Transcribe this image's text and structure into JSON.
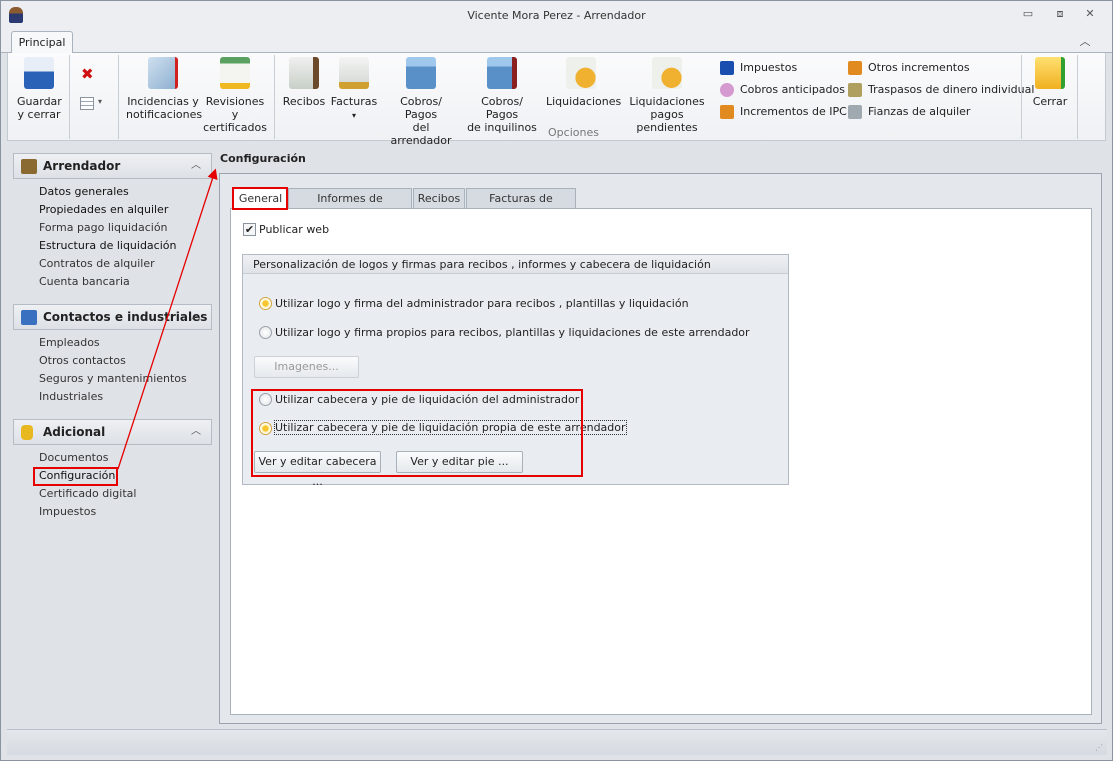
{
  "window": {
    "title": "Vicente Mora Perez - Arrendador",
    "minimize": "▭",
    "restore": "⧈",
    "close": "✕",
    "collapse": "︿"
  },
  "ribbon": {
    "tab": "Principal",
    "buttons": [
      {
        "label1": "Guardar",
        "label2": "y cerrar",
        "icon": "save-icon"
      },
      {
        "label1": "Incidencias y",
        "label2": "notificaciones",
        "icon": "incidents-icon"
      },
      {
        "label1": "Revisiones y",
        "label2": "certificados",
        "icon": "bell-icon"
      },
      {
        "label1": "Recibos",
        "label2": "",
        "icon": "receipt-icon"
      },
      {
        "label1": "Facturas",
        "label2": "▾",
        "icon": "invoice-icon"
      },
      {
        "label1": "Cobros/ Pagos",
        "label2": "del arrendador",
        "icon": "calculator-icon"
      },
      {
        "label1": "Cobros/ Pagos",
        "label2": "de inquilinos",
        "icon": "calculator-user-icon"
      },
      {
        "label1": "Liquidaciones",
        "label2": "",
        "icon": "certificate-icon"
      },
      {
        "label1": "Liquidaciones",
        "label2": "pagos pendientes",
        "icon": "certificate-icon"
      },
      {
        "label1": "Cerrar",
        "label2": "",
        "icon": "folder-exit-icon"
      }
    ],
    "small": [
      {
        "label": "Impuestos",
        "color": "#1a4fb0"
      },
      {
        "label": "Cobros anticipados",
        "color": "#d59ad0"
      },
      {
        "label": "Incrementos de IPC",
        "color": "#e08a20"
      },
      {
        "label": "Otros incrementos",
        "color": "#e08a20"
      },
      {
        "label": "Traspasos de dinero individual",
        "color": "#b0a060"
      },
      {
        "label": "Fianzas de alquiler",
        "color": "#a0a8b0"
      }
    ],
    "group_label": "Opciones"
  },
  "sidebar": {
    "sections": [
      {
        "title": "Arrendador",
        "items": [
          "Datos generales",
          "Propiedades en alquiler",
          "Forma pago liquidación",
          "Estructura de liquidación",
          "Contratos de alquiler",
          "Cuenta bancaria"
        ]
      },
      {
        "title": "Contactos e industriales",
        "items": [
          "Empleados",
          "Otros contactos",
          "Seguros y mantenimientos",
          "Industriales"
        ]
      },
      {
        "title": "Adicional",
        "items": [
          "Documentos",
          "Configuración",
          "Certificado digital",
          "Impuestos"
        ]
      }
    ]
  },
  "main": {
    "title": "Configuración",
    "tabs": [
      "General",
      "Informes de liquidación",
      "Recibos",
      "Facturas de alquiler"
    ],
    "publicar_web": "Publicar web",
    "group_title": "Personalización de logos y firmas para recibos , informes y cabecera de liquidación",
    "radio1": "Utilizar logo y firma del administrador para recibos , plantillas y liquidación",
    "radio2": "Utilizar logo y firma propios para recibos, plantillas y liquidaciones de este arrendador",
    "imagenes": "Imagenes...",
    "radio3": "Utilizar cabecera y pie de liquidación del administrador",
    "radio4": "Utilizar cabecera y pie de liquidación propia de este arrendador",
    "ver_cabecera": "Ver y editar cabecera ...",
    "ver_pie": "Ver y editar pie ..."
  },
  "accent": "#e60000"
}
